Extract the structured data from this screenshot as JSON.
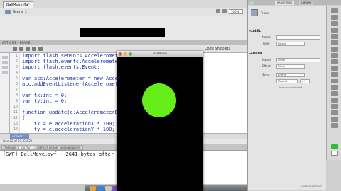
{
  "document": {
    "tab_label": "BallMove.fla*",
    "scene_label": "Scene 1",
    "zoom": "100%"
  },
  "actions_panel": {
    "title": "ACTIONS - FRAME",
    "code_snippets_label": "Code Snippets",
    "editor_tab": "Actions : 1",
    "status": "Line 22 of 23, Col 29",
    "line_numbers": [
      "1",
      "2",
      "3",
      "4",
      "5",
      "6",
      "7",
      "8",
      "9",
      "10",
      "11",
      "12",
      "13",
      "14"
    ],
    "code_lines": [
      "import flash.sensors.Accelerometer;",
      "import flash.events.AccelerometerEvent;",
      "import flash.events.Event;",
      "",
      "var acc:Accelerometer = new Accele",
      "acc.addEventListener(AccelerometerEv",
      "",
      "var tx:int = 0;",
      "var ty:int = 0;",
      "",
      "function update(e:AccelerometerEv",
      "{",
      "    tx = e.accelerationX * 100;",
      "    ty = e.accelerationY * 100;"
    ]
  },
  "bottom_panel": {
    "tabs": [
      "TIMELINE",
      "OUTPUT",
      "COMPILER ERRORS",
      "MOTION EDITOR"
    ],
    "output_text": "[SWF] BallMove.swf - 2641 bytes after"
  },
  "player": {
    "title": "BallMove",
    "ball_color": "#66ee1a"
  },
  "properties": {
    "tabs": [
      "PROPERTIES",
      "LIBRARY"
    ],
    "instance_label": "Frame",
    "label_header": "LABEL",
    "name_label": "Name:",
    "type_label": "Type:",
    "type_value": "Name",
    "sound_header": "SOUND",
    "sound_name_label": "Name:",
    "sound_name_value": "None",
    "effect_label": "Effect:",
    "effect_value": "None",
    "sync_label": "Sync:",
    "sync_value": "Event",
    "repeat_label": "Repeat",
    "repeat_value": "x 1",
    "no_sound_hint": "No sound selected",
    "code_assist": "CODE ASSISTANT"
  },
  "colors": {
    "accent_tab": "#6f8fc3",
    "code_text": "#1f2fa0",
    "tool_green": "#2bbf2b"
  }
}
